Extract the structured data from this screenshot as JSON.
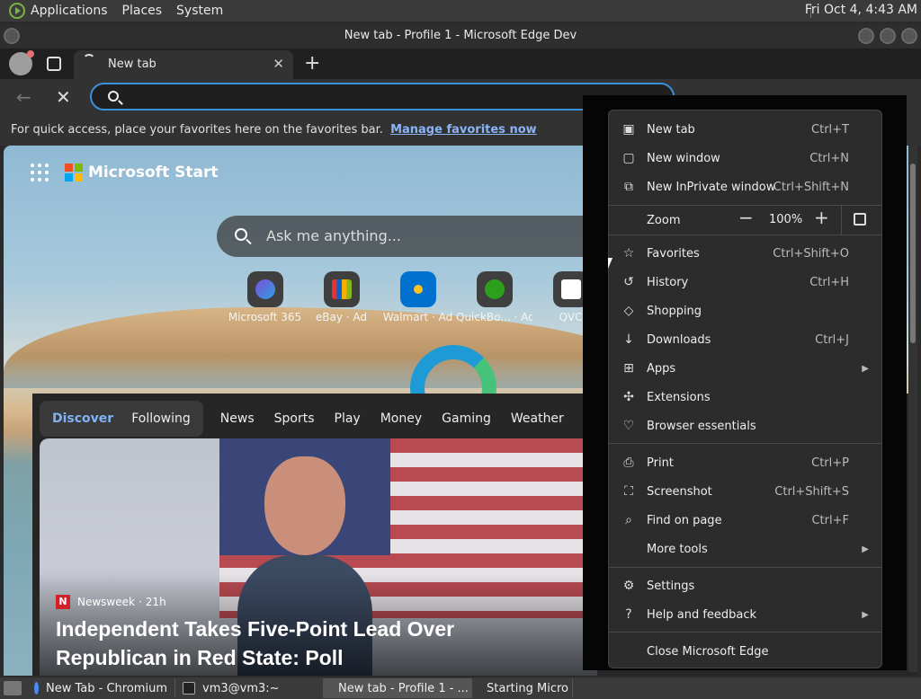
{
  "panel": {
    "menus": [
      "Applications",
      "Places",
      "System"
    ],
    "clock": "Fri Oct  4,  4:43 AM"
  },
  "window": {
    "title": "New tab - Profile 1 - Microsoft Edge Dev"
  },
  "tabs": {
    "active_title": "New tab"
  },
  "address": {
    "value": ""
  },
  "favbar": {
    "hint": "For quick access, place your favorites here on the favorites bar.",
    "link": "Manage favorites now"
  },
  "start": {
    "brand": "Microsoft Start",
    "search_placeholder": "Ask me anything...",
    "quick_links": [
      {
        "label": "Microsoft 365",
        "color": "#7b4fd6"
      },
      {
        "label": "eBay · Ad",
        "color": "#e53238"
      },
      {
        "label": "Walmart · Ad",
        "color": "#0071ce"
      },
      {
        "label": "QuickBo... · Ad",
        "color": "#2ca01c"
      },
      {
        "label": "QVC",
        "color": "#ffffff"
      }
    ]
  },
  "feed": {
    "primary_tabs": [
      "Discover",
      "Following"
    ],
    "categories": [
      "News",
      "Sports",
      "Play",
      "Money",
      "Gaming",
      "Weather"
    ],
    "card": {
      "source": "Newsweek",
      "age": "21h",
      "headline": "Independent Takes Five-Point Lead Over Republican in Red State: Poll"
    }
  },
  "menu": {
    "items": [
      {
        "icon": "new-tab-icon",
        "label": "New tab",
        "shortcut": "Ctrl+T"
      },
      {
        "icon": "new-window-icon",
        "label": "New window",
        "shortcut": "Ctrl+N"
      },
      {
        "icon": "inprivate-icon",
        "label": "New InPrivate window",
        "shortcut": "Ctrl+Shift+N"
      },
      {
        "icon": "zoom",
        "label": "Zoom",
        "value": "100%"
      },
      {
        "icon": "favorites-icon",
        "label": "Favorites",
        "shortcut": "Ctrl+Shift+O"
      },
      {
        "icon": "history-icon",
        "label": "History",
        "shortcut": "Ctrl+H"
      },
      {
        "icon": "shopping-icon",
        "label": "Shopping",
        "shortcut": ""
      },
      {
        "icon": "downloads-icon",
        "label": "Downloads",
        "shortcut": "Ctrl+J"
      },
      {
        "icon": "apps-icon",
        "label": "Apps",
        "shortcut": ""
      },
      {
        "icon": "extensions-icon",
        "label": "Extensions",
        "shortcut": ""
      },
      {
        "icon": "browser-essentials-icon",
        "label": "Browser essentials",
        "shortcut": ""
      },
      {
        "icon": "print-icon",
        "label": "Print",
        "shortcut": "Ctrl+P"
      },
      {
        "icon": "screenshot-icon",
        "label": "Screenshot",
        "shortcut": "Ctrl+Shift+S"
      },
      {
        "icon": "find-icon",
        "label": "Find on page",
        "shortcut": "Ctrl+F"
      },
      {
        "icon": "",
        "label": "More tools",
        "shortcut": ""
      },
      {
        "icon": "settings-icon",
        "label": "Settings",
        "shortcut": ""
      },
      {
        "icon": "help-icon",
        "label": "Help and feedback",
        "shortcut": ""
      },
      {
        "icon": "",
        "label": "Close Microsoft Edge",
        "shortcut": ""
      }
    ]
  },
  "taskbar": {
    "items": [
      "New Tab - Chromium",
      "vm3@vm3:~",
      "New tab - Profile 1 - ...",
      "Starting Micro"
    ]
  }
}
